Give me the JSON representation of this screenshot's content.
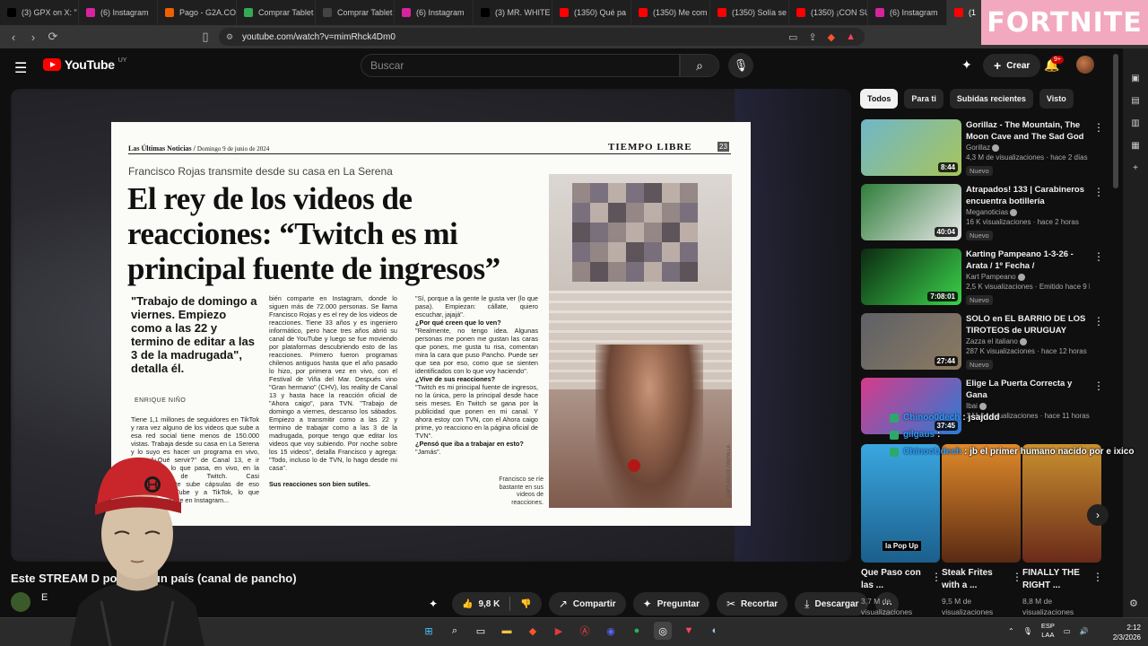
{
  "browser": {
    "tabs": [
      {
        "label": "(3) GPX on X: \"",
        "fav": "#000000"
      },
      {
        "label": "(6) Instagram",
        "fav": "#d6249f"
      },
      {
        "label": "Pago - G2A.CO",
        "fav": "#f05f00"
      },
      {
        "label": "Comprar Tablet",
        "fav": "#33aa55"
      },
      {
        "label": "Comprar Tablet",
        "fav": "#444444"
      },
      {
        "label": "(6) Instagram",
        "fav": "#d6249f"
      },
      {
        "label": "(3) MR. WHITE",
        "fav": "#000000"
      },
      {
        "label": "(1350) Qué pa",
        "fav": "#ff0000"
      },
      {
        "label": "(1350) Me com",
        "fav": "#ff0000"
      },
      {
        "label": "(1350) Solía se",
        "fav": "#ff0000"
      },
      {
        "label": "(1350) ¡CON SU",
        "fav": "#ff0000"
      },
      {
        "label": "(6) Instagram",
        "fav": "#d6249f"
      },
      {
        "label": "(1",
        "fav": "#ff0000"
      }
    ],
    "url": "youtube.com/watch?v=mimRhck4Dm0"
  },
  "overlay": {
    "fortnite": "FORTNITE"
  },
  "youtube": {
    "logo_text": "YouTube",
    "country_code": "UY",
    "search_placeholder": "Buscar",
    "create_label": "Crear",
    "notif_badge": "9+"
  },
  "newspaper": {
    "masthead": "Las Últimas Noticias",
    "date": "Domingo 9 de junio de 2024",
    "section": "TIEMPO LIBRE",
    "page_number": "23",
    "kicker": "Francisco Rojas transmite desde su casa en La Serena",
    "headline": "El rey de los videos de reacciones: “Twitch es mi principal fuente de ingresos”",
    "lead": "\"Trabajo de domingo a viernes. Empiezo como a las 22 y termino de editar a las 3 de la madrugada\", detalla él.",
    "byline": "ENRIQUE NIÑO",
    "col1": "Tiene 1,1 millones de seguidores en TikTok y rara vez alguno de los videos que sube a esa red social tiene menos de 150.000 vistas. Trabaja desde su casa en La Serena y lo suyo es hacer un programa en vivo, como \"¿Qué servir?\" de Canal 13, e ir comentando lo que pasa, en vivo, en la plataforma de Twitch. Casi simultáneamente sube cápsulas de eso mismo a YouTube y a TikTok, lo que también comparte en Instagram...",
    "col2": "bién comparte en Instagram, donde lo siguen más de 72.000 personas. Se llama Francisco Rojas y es el rey de los videos de reacciones. Tiene 33 años y es ingeniero informático, pero hace tres años abrió su canal de YouTube y luego se fue moviendo por plataformas descubriendo esto de las reacciones. Primero fueron programas chilenos antiguos hasta que el año pasado lo hizo, por primera vez en vivo, con el Festival de Viña del Mar. Después vino \"Gran hermano\" (CHV), los reality de Canal 13 y hasta hace la reacción oficial de \"Ahora caigo\", para TVN. \"Trabajo de domingo a viernes, descanso los sábados. Empiezo a transmitir como a las 22 y termino de trabajar como a las 3 de la madrugada, porque tengo que editar los videos que voy subiendo. Por noche sobre los 15 videos\", detalla Francisco y agrega: \"Todo, incluso lo de TVN, lo hago desde mi casa\".",
    "col2_sub": "Sus reacciones son bien sutiles.",
    "col3": "\"Sí, porque a la gente le gusta ver (lo que pasa). Empiezan: cállate, quiero escuchar, jajajá\".",
    "col3_q1": "¿Por qué creen que lo ven?",
    "col3_p2": "\"Realmente, no tengo idea. Algunas personas me ponen me gustan las caras que pones, me gusta tu risa, comentan mira la cara que puso Pancho. Puede ser que sea por eso, como que se sienten identificados con lo que voy haciendo\".",
    "col3_q2": "¿Vive de sus reacciones?",
    "col3_p3": "\"Twitch es mi principal fuente de ingresos, no la única, pero la principal desde hace seis meses. En Twitch se gana por la publicidad que ponen en mi canal. Y ahora estoy con TVN, con el Ahora caigo prime, yo reacciono en la página oficial de TVN\".",
    "col3_q3": "¿Pensó que iba a trabajar en esto?",
    "col3_p4": "\"Jamás\".",
    "caption": "Francisco se ríe bastante en sus videos de reacciones.",
    "credit": "CAPTURA DE PANTALLA"
  },
  "video": {
    "title": "Este STREAM        D por todo un país (canal de pancho)",
    "channel_initial": "E"
  },
  "actions": {
    "likes": "9,8 K",
    "share": "Compartir",
    "ask": "Preguntar",
    "clip": "Recortar",
    "download": "Descargar"
  },
  "chips": [
    "Todos",
    "Para ti",
    "Subidas recientes",
    "Visto"
  ],
  "recommendations": [
    {
      "title": "Gorillaz - The Mountain, The Moon Cave and The Sad God",
      "channel": "Gorillaz",
      "meta": "4,3 M de visualizaciones · hace 2 días",
      "badge": "Nuevo",
      "duration": "8:44",
      "colors": [
        "#6fb6c9",
        "#a7c55a"
      ]
    },
    {
      "title": "Atrapados! 133 | Carabineros encuentra botillería clandestin...",
      "channel": "Meganoticias",
      "meta": "16 K visualizaciones · hace 2 horas",
      "badge": "Nuevo",
      "duration": "40:04",
      "colors": [
        "#2f7d3a",
        "#e9e9e9"
      ]
    },
    {
      "title": "Karting Pampeano 1-3-26 - Arata / 1º Fecha / Kartódromo...",
      "channel": "Kart Pampeano",
      "meta": "2,5 K visualizaciones · Emitido hace 9 ho...",
      "badge": "Nuevo",
      "duration": "7:08:01",
      "colors": [
        "#0c2a12",
        "#3bd24a"
      ]
    },
    {
      "title": "SOLO en EL BARRIO DE LOS TIROTEOS de URUGUAY",
      "channel": "Zazza el italiano",
      "meta": "287 K visualizaciones · hace 12 horas",
      "badge": "Nuevo",
      "duration": "27:44",
      "colors": [
        "#5d6166",
        "#8d7a62"
      ]
    },
    {
      "title": "Elige La Puerta Correcta y Gana",
      "channel": "Ibai",
      "meta": "1 M de visualizaciones · hace 11 horas",
      "badge": "",
      "duration": "37:45",
      "colors": [
        "#d83a8a",
        "#2a7cd6"
      ]
    }
  ],
  "chat": [
    {
      "user": "Chinoo0dech",
      "msg": ": jsajddd"
    },
    {
      "user": "gilgaus",
      "msg": ":"
    },
    {
      "user": "ChinooUdech",
      "msg": ": jb el primer humano nacido por e ixico"
    }
  ],
  "shorts": [
    {
      "title": "Que Paso con las ...",
      "views": "3,7 M de visualizaciones",
      "thumb_label": "la Pop Up",
      "colors": [
        "#3aa7e0",
        "#1b5f8c"
      ]
    },
    {
      "title": "Steak Frites with a ...",
      "views": "9,5 M de visualizaciones",
      "thumb_label": "",
      "colors": [
        "#e08a2a",
        "#5a2a14"
      ]
    },
    {
      "title": "FINALLY THE RIGHT ...",
      "views": "8,8 M de visualizaciones",
      "thumb_label": "",
      "colors": [
        "#c9902e",
        "#6a2a1a"
      ]
    }
  ],
  "taskbar": {
    "lang": "ESP",
    "lang2": "LAA",
    "time": "2:12",
    "date": "2/3/2026"
  }
}
